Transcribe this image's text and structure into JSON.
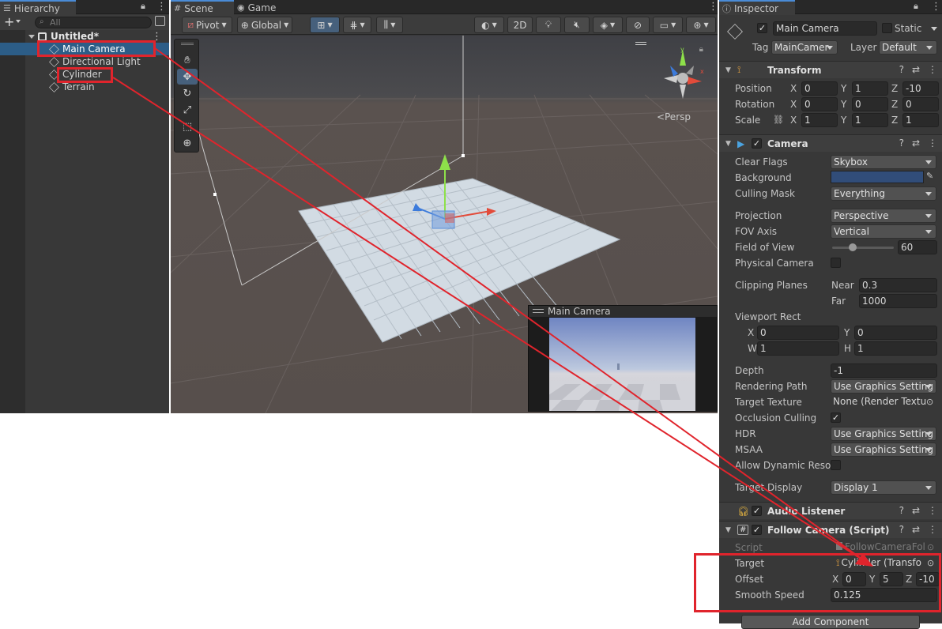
{
  "hierarchy": {
    "tab_label": "Hierarchy",
    "search_placeholder": "All",
    "scene_name": "Untitled*",
    "items": [
      {
        "label": "Main Camera",
        "selected": true
      },
      {
        "label": "Directional Light",
        "selected": false
      },
      {
        "label": "Cylinder",
        "selected": false
      },
      {
        "label": "Terrain",
        "selected": false
      }
    ]
  },
  "scene": {
    "tabs": [
      {
        "label": "Scene",
        "icon": "grid-icon"
      },
      {
        "label": "Game",
        "icon": "gamepad-icon"
      }
    ],
    "pivot_label": "Pivot",
    "global_label": "Global",
    "mode_2d_label": "2D",
    "persp_label": "Persp",
    "camera_preview_title": "Main Camera"
  },
  "inspector": {
    "tab_label": "Inspector",
    "object_name": "Main Camera",
    "static_label": "Static",
    "tag_label": "Tag",
    "tag_value": "MainCamer",
    "layer_label": "Layer",
    "layer_value": "Default",
    "transform": {
      "title": "Transform",
      "position_label": "Position",
      "position": {
        "x": "0",
        "y": "1",
        "z": "-10"
      },
      "rotation_label": "Rotation",
      "rotation": {
        "x": "0",
        "y": "0",
        "z": "0"
      },
      "scale_label": "Scale",
      "scale": {
        "x": "1",
        "y": "1",
        "z": "1"
      }
    },
    "camera": {
      "title": "Camera",
      "clear_flags_label": "Clear Flags",
      "clear_flags": "Skybox",
      "background_label": "Background",
      "background_color": "#314d79",
      "culling_mask_label": "Culling Mask",
      "culling_mask": "Everything",
      "projection_label": "Projection",
      "projection": "Perspective",
      "fov_axis_label": "FOV Axis",
      "fov_axis": "Vertical",
      "fov_label": "Field of View",
      "fov": "60",
      "fov_slider_fraction": 0.33,
      "physical_camera_label": "Physical Camera",
      "clipping_planes_label": "Clipping Planes",
      "near_label": "Near",
      "near": "0.3",
      "far_label": "Far",
      "far": "1000",
      "viewport_rect_label": "Viewport Rect",
      "vp": {
        "x": "0",
        "y": "0",
        "w": "1",
        "h": "1"
      },
      "depth_label": "Depth",
      "depth": "-1",
      "rendering_path_label": "Rendering Path",
      "rendering_path": "Use Graphics Setting",
      "target_texture_label": "Target Texture",
      "target_texture": "None (Render Textu",
      "occlusion_culling_label": "Occlusion Culling",
      "hdr_label": "HDR",
      "hdr": "Use Graphics Setting",
      "msaa_label": "MSAA",
      "msaa": "Use Graphics Setting",
      "allow_dynamic_label": "Allow Dynamic Resol",
      "target_display_label": "Target Display",
      "target_display": "Display 1"
    },
    "audio_listener": {
      "title": "Audio Listener"
    },
    "follow_camera": {
      "title": "Follow Camera (Script)",
      "script_label": "Script",
      "script_value": "FollowCameraFoll",
      "target_label": "Target",
      "target_value": "Cylinder (Transfo",
      "offset_label": "Offset",
      "offset": {
        "x": "0",
        "y": "5",
        "z": "-10"
      },
      "smooth_speed_label": "Smooth Speed",
      "smooth_speed": "0.125"
    },
    "add_component_label": "Add Component"
  },
  "colors": {
    "annotation_red": "#e0242c",
    "selection_blue": "#2c5d87",
    "accent_blue": "#4a8bd6"
  }
}
